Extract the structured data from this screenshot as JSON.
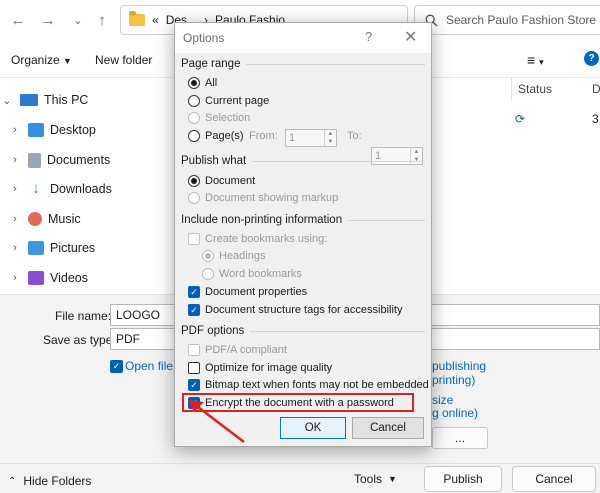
{
  "window": {
    "address": {
      "prefix": "«",
      "crumb1": "Des...",
      "crumb2": "Paulo Fashio..."
    },
    "search_placeholder": "Search Paulo Fashion Store",
    "toolbar": {
      "organize": "Organize",
      "new_folder": "New folder"
    },
    "sidebar": [
      {
        "label": "This PC",
        "icon": "this-pc-icon"
      },
      {
        "label": "Desktop",
        "icon": "desktop-icon"
      },
      {
        "label": "Documents",
        "icon": "documents-icon"
      },
      {
        "label": "Downloads",
        "icon": "downloads-icon"
      },
      {
        "label": "Music",
        "icon": "music-icon"
      },
      {
        "label": "Pictures",
        "icon": "pictures-icon"
      },
      {
        "label": "Videos",
        "icon": "videos-icon"
      }
    ],
    "columns": {
      "status": "Status",
      "date_partial": "D"
    },
    "row": {
      "date_partial": "3,"
    },
    "file_name_label": "File name:",
    "file_name_value": "LOOGO",
    "save_as_type_label": "Save as type:",
    "save_as_type_value": "PDF",
    "open_file_label": "Open file a",
    "publish_option_1": "publishing",
    "publish_option_1b": "printing)",
    "publish_option_2": "size",
    "publish_option_2b": "g online)",
    "ellipsis_button": "...",
    "hide_folders": "Hide Folders",
    "tools": "Tools",
    "publish": "Publish",
    "cancel": "Cancel"
  },
  "options_dialog": {
    "title": "Options",
    "help": "?",
    "close": "✕",
    "page_range": {
      "header": "Page range",
      "all": "All",
      "current_page": "Current page",
      "selection": "Selection",
      "pages": "Page(s)",
      "from_label": "From:",
      "from_value": "1",
      "to_label": "To:",
      "to_value": "1"
    },
    "publish_what": {
      "header": "Publish what",
      "document": "Document",
      "document_markup": "Document showing markup"
    },
    "non_printing": {
      "header": "Include non-printing information",
      "bookmarks": "Create bookmarks using:",
      "headings": "Headings",
      "word_bookmarks": "Word bookmarks",
      "doc_properties": "Document properties",
      "structure_tags": "Document structure tags for accessibility"
    },
    "pdf_options": {
      "header": "PDF options",
      "pdfa": "PDF/A compliant",
      "optimize": "Optimize for image quality",
      "bitmap": "Bitmap text when fonts may not be embedded",
      "encrypt": "Encrypt the document with a password"
    },
    "ok": "OK",
    "cancel": "Cancel"
  },
  "colors": {
    "accent": "#005fb8",
    "highlight": "#e02020"
  }
}
